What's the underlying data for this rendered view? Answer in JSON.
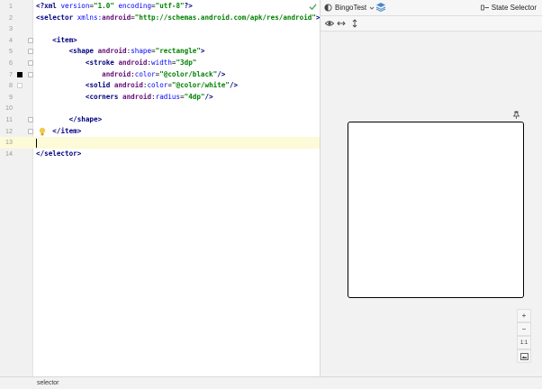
{
  "editor": {
    "lines": [
      {
        "n": "1",
        "html": "<span class=\"tok-tag\">&lt;?xml </span><span class=\"tok-attr\">version</span>=<span class=\"tok-val\">\"1.0\"</span> <span class=\"tok-attr\">encoding</span>=<span class=\"tok-val\">\"utf-8\"</span><span class=\"tok-tag\">?&gt;</span>"
      },
      {
        "n": "2",
        "html": "<span class=\"tok-tag\">&lt;selector </span><span class=\"tok-attr\">xmlns:</span><span class=\"tok-ns\">android</span>=<span class=\"tok-val\">\"http://schemas.android.com/apk/res/android\"</span><span class=\"tok-tag\">&gt;</span>"
      },
      {
        "n": "3",
        "html": ""
      },
      {
        "n": "4",
        "html": "    <span class=\"tok-tag\">&lt;item&gt;</span>"
      },
      {
        "n": "5",
        "html": "        <span class=\"tok-tag\">&lt;shape </span><span class=\"tok-ns\">android</span>:<span class=\"tok-attr\">shape</span>=<span class=\"tok-val\">\"rectangle\"</span><span class=\"tok-tag\">&gt;</span>"
      },
      {
        "n": "6",
        "html": "            <span class=\"tok-tag\">&lt;stroke </span><span class=\"tok-ns\">android</span>:<span class=\"tok-attr\">width</span>=<span class=\"tok-val\">\"3dp\"</span>"
      },
      {
        "n": "7",
        "html": "                <span class=\"tok-ns\">android</span>:<span class=\"tok-attr\">color</span>=<span class=\"tok-val\">\"@color/black\"</span><span class=\"tok-tag\">/&gt;</span>"
      },
      {
        "n": "8",
        "html": "            <span class=\"tok-tag\">&lt;solid </span><span class=\"tok-ns\">android</span>:<span class=\"tok-attr\">color</span>=<span class=\"tok-val\">\"@color/white\"</span><span class=\"tok-tag\">/&gt;</span>"
      },
      {
        "n": "9",
        "html": "            <span class=\"tok-tag\">&lt;corners </span><span class=\"tok-ns\">android</span>:<span class=\"tok-attr\">radius</span>=<span class=\"tok-val\">\"4dp\"</span><span class=\"tok-tag\">/&gt;</span>"
      },
      {
        "n": "10",
        "html": ""
      },
      {
        "n": "11",
        "html": "        <span class=\"tok-tag\">&lt;/shape&gt;</span>"
      },
      {
        "n": "12",
        "html": "    <span class=\"tok-tag\">&lt;/item&gt;</span>"
      },
      {
        "n": "13",
        "html": ""
      },
      {
        "n": "14",
        "html": "<span class=\"tok-tag\">&lt;/selector&gt;</span>"
      }
    ],
    "current_line": "13",
    "swatches": {
      "7": "black",
      "8": "white"
    },
    "fold_lines": [
      "4",
      "5",
      "6",
      "7",
      "11",
      "12"
    ],
    "bulb_line": "12",
    "status_icon": "checkmark-icon"
  },
  "preview": {
    "theme_label": "BingoTest",
    "state_selector_label": "State Selector",
    "zoom_in": "+",
    "zoom_out": "−",
    "zoom_actual": "1:1",
    "icons": [
      "theme-icon",
      "layers-icon",
      "eye-icon",
      "horizontal-resize-icon",
      "vertical-resize-icon",
      "pin-icon",
      "screenshot-icon"
    ]
  },
  "status_bar": {
    "breadcrumb": "selector"
  },
  "colors": {
    "tag": "#000080",
    "attr": "#0000ff",
    "namespace": "#660e7a",
    "value": "#008000",
    "check": "#59a869",
    "current_line": "#fcfad7"
  }
}
